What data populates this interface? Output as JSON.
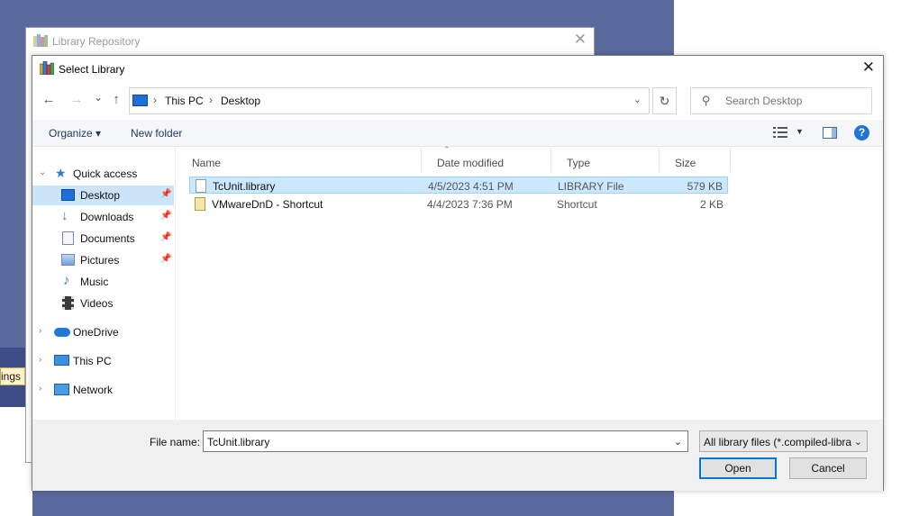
{
  "background": {
    "tag_text": "ings",
    "window_title": "Library Repository",
    "close_glyph": "✕"
  },
  "dialog": {
    "title": "Select Library",
    "close_glyph": "✕",
    "colors": {
      "accent": "#0078d7",
      "selection": "#cce8ff",
      "nav_selection": "#cce4f7"
    }
  },
  "navigation": {
    "back": "←",
    "forward": "→",
    "recent": "⌄",
    "up": "↑",
    "breadcrumb": [
      "This PC",
      "Desktop"
    ],
    "refresh": "↻",
    "search_placeholder": "Search Desktop"
  },
  "toolbar": {
    "organize": "Organize ▾",
    "new_folder": "New folder",
    "view_dropdown": "▼",
    "help": "?"
  },
  "sidebar": {
    "items": [
      {
        "label": "Quick access",
        "icon": "star-icon"
      },
      {
        "label": "Desktop",
        "icon": "desktop-icon",
        "selected": true,
        "pinned": true
      },
      {
        "label": "Downloads",
        "icon": "download-icon",
        "pinned": true
      },
      {
        "label": "Documents",
        "icon": "documents-icon",
        "pinned": true
      },
      {
        "label": "Pictures",
        "icon": "pictures-icon",
        "pinned": true
      },
      {
        "label": "Music",
        "icon": "music-icon"
      },
      {
        "label": "Videos",
        "icon": "videos-icon"
      },
      {
        "label": "OneDrive",
        "icon": "cloud-icon"
      },
      {
        "label": "This PC",
        "icon": "computer-icon"
      },
      {
        "label": "Network",
        "icon": "network-icon"
      }
    ]
  },
  "files": {
    "columns": [
      "Name",
      "Date modified",
      "Type",
      "Size"
    ],
    "rows": [
      {
        "name": "TcUnit.library",
        "date": "4/5/2023 4:51 PM",
        "type": "LIBRARY File",
        "size": "579 KB",
        "selected": true
      },
      {
        "name": "VMwareDnD - Shortcut",
        "date": "4/4/2023 7:36 PM",
        "type": "Shortcut",
        "size": "2 KB"
      }
    ]
  },
  "footer": {
    "filename_label": "File name:",
    "filename_value": "TcUnit.library",
    "filter": "All library files (*.compiled-library)",
    "open": "Open",
    "cancel": "Cancel"
  }
}
